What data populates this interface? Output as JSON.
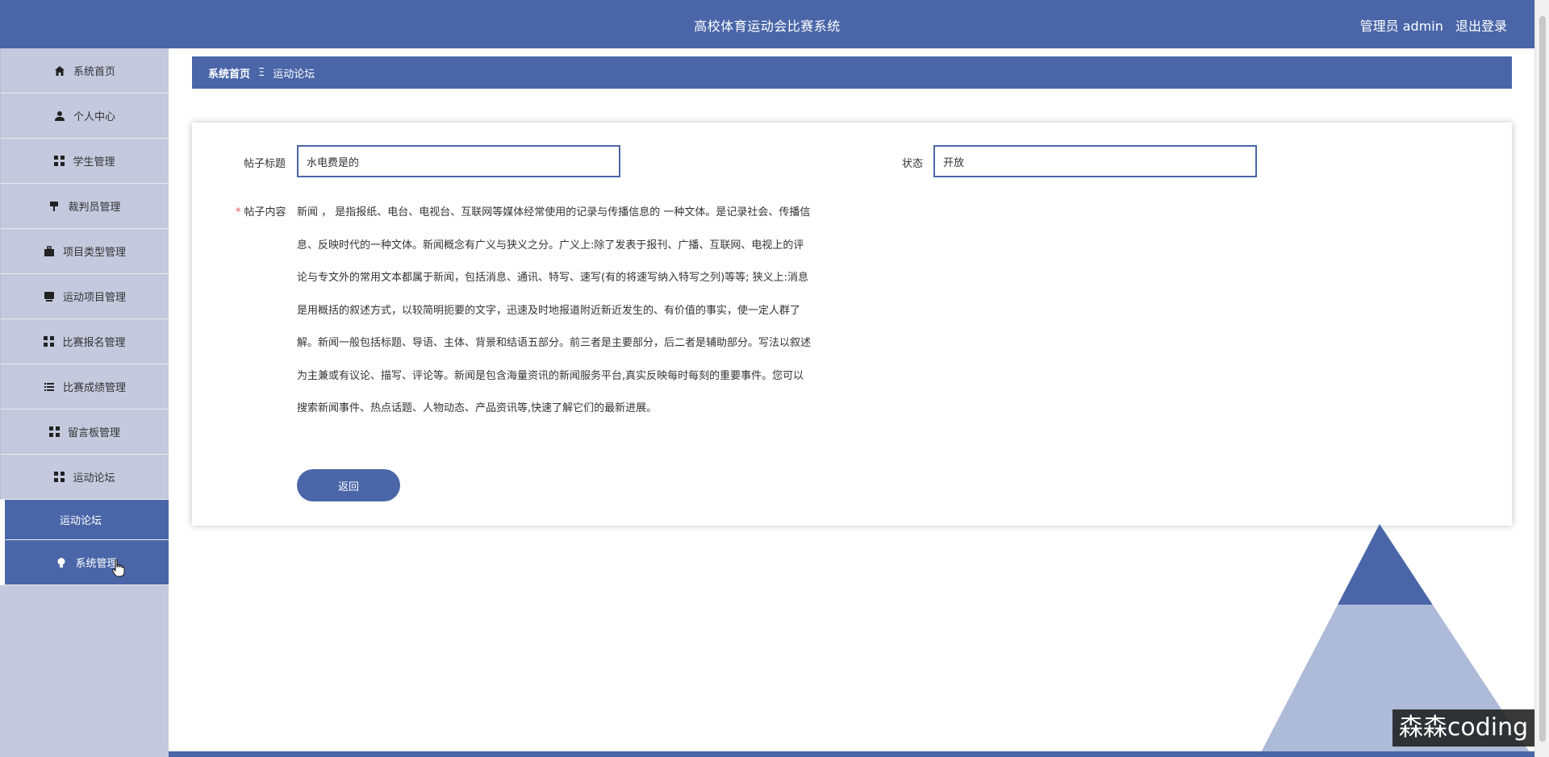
{
  "header": {
    "title": "高校体育运动会比赛系统",
    "user_label": "管理员 admin",
    "logout_label": "退出登录"
  },
  "sidebar": {
    "items": [
      {
        "label": "系统首页",
        "icon": "home-icon"
      },
      {
        "label": "个人中心",
        "icon": "user-icon"
      },
      {
        "label": "学生管理",
        "icon": "grid-icon"
      },
      {
        "label": "裁判员管理",
        "icon": "flag-icon"
      },
      {
        "label": "项目类型管理",
        "icon": "briefcase-icon"
      },
      {
        "label": "运动项目管理",
        "icon": "monitor-icon"
      },
      {
        "label": "比赛报名管理",
        "icon": "grid-icon"
      },
      {
        "label": "比赛成绩管理",
        "icon": "list-icon"
      },
      {
        "label": "留言板管理",
        "icon": "grid-icon"
      },
      {
        "label": "运动论坛",
        "icon": "grid-icon"
      }
    ],
    "sub_item": "运动论坛",
    "active_item": {
      "label": "系统管理",
      "icon": "bulb-icon"
    }
  },
  "breadcrumb": {
    "home": "系统首页",
    "separator": "Ξ",
    "current": "运动论坛"
  },
  "form": {
    "title_label": "帖子标题",
    "title_value": "水电费是的",
    "status_label": "状态",
    "status_value": "开放",
    "content_required": "*",
    "content_label": "帖子内容",
    "content_lines": [
      "新闻 ， 是指报纸、电台、电视台、互联网等媒体经常使用的记录与传播信息的 一种文体。是记录社会、传播信",
      "息、反映时代的一种文体。新闻概念有广义与狭义之分。广义上:除了发表于报刊、广播、互联网、电视上的评",
      "论与专文外的常用文本都属于新闻，包括消息、通讯、特写、速写(有的将速写纳入特写之列)等等; 狭义上:消息",
      "是用概括的叙述方式，以较简明扼要的文字，迅速及时地报道附近新近发生的、有价值的事实，使一定人群了",
      "解。新闻一般包括标题、导语、主体、背景和结语五部分。前三者是主要部分，后二者是辅助部分。写法以叙述",
      "为主兼或有议论、描写、评论等。新闻是包含海量资讯的新闻服务平台,真实反映每时每刻的重要事件。您可以",
      "搜索新闻事件、热点话题、人物动态、产品资讯等,快速了解它们的最新进展。"
    ],
    "back_button": "返回"
  },
  "watermark": "森森coding",
  "colors": {
    "primary": "#4a66a8",
    "sidebar_bg": "#c5c9de"
  }
}
